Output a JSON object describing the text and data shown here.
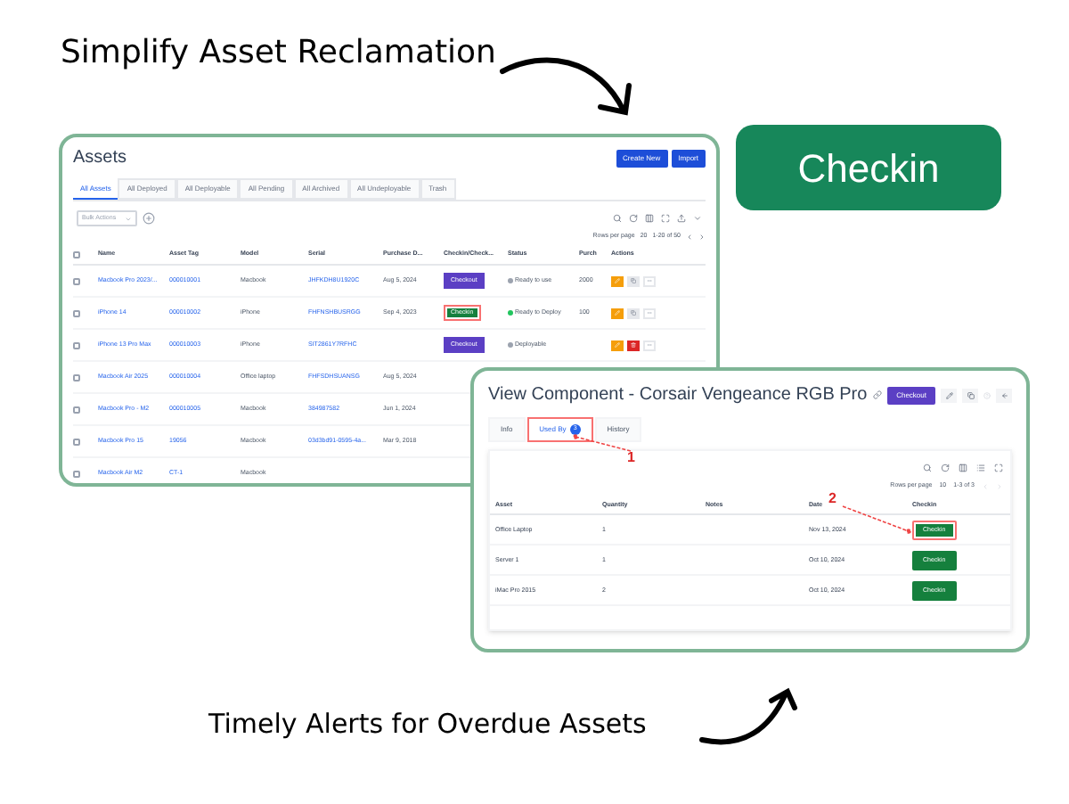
{
  "headline_top": "Simplify Asset Reclamation",
  "feature_button": "Checkin",
  "assets_window": {
    "title": "Assets",
    "buttons": [
      "Create New",
      "Import"
    ],
    "tabs": [
      {
        "label": "All Assets",
        "selected": true
      },
      {
        "label": "All Deployed",
        "selected": false
      },
      {
        "label": "All Deployable",
        "selected": false
      },
      {
        "label": "All Pending",
        "selected": false
      },
      {
        "label": "All Archived",
        "selected": false
      },
      {
        "label": "All Undeployable",
        "selected": false
      },
      {
        "label": "Trash",
        "selected": false
      }
    ],
    "bulk_select": {
      "placeholder": "Bulk Actions"
    },
    "rows_per_page_label": "Rows per page",
    "rows_per_page": "20",
    "range": "1-20 of 50",
    "header_checked": false,
    "columns": [
      "Name",
      "Asset Tag",
      "Model",
      "Serial",
      "Purchase D...",
      "Checkin/Check...",
      "Status",
      "Purch",
      "Actions"
    ],
    "rows": [
      {
        "checked": false,
        "name": "Macbook Pro 2023/...",
        "asset_tag": "000010001",
        "model": "Macbook",
        "serial": "JHFKDH8U1920C",
        "purchase_date": "Aug 5, 2024",
        "action": {
          "kind": "checkout",
          "label": "Checkout",
          "highlighted": false
        },
        "status": "Ready to use",
        "color": "#9ca3af",
        "cost": "2000",
        "deletable": false
      },
      {
        "checked": false,
        "name": "iPhone 14",
        "asset_tag": "000010002",
        "model": "iPhone",
        "serial": "FHFNSHBUSRGG",
        "purchase_date": "Sep 4, 2023",
        "action": {
          "kind": "checkin",
          "label": "Checkin",
          "highlighted": true
        },
        "status": "Ready to Deploy",
        "color": "#22c55e",
        "cost": "100",
        "deletable": false
      },
      {
        "checked": false,
        "name": "iPhone 13 Pro Max",
        "asset_tag": "000010003",
        "model": "iPhone",
        "serial": "SIT2861Y7RFHC",
        "action": {
          "kind": "checkout",
          "label": "Checkout",
          "highlighted": false
        },
        "status": "Deployable",
        "color": "#9ca3af",
        "deletable": true
      },
      {
        "checked": false,
        "name": "Macbook Air 2025",
        "asset_tag": "000010004",
        "model": "Office laptop",
        "serial": "FHFSDHSUANSG",
        "purchase_date": "Aug 5, 2024"
      },
      {
        "checked": false,
        "name": "Macbook Pro - M2",
        "asset_tag": "000010005",
        "model": "Macbook",
        "serial": "384987582",
        "purchase_date": "Jun 1, 2024"
      },
      {
        "checked": false,
        "name": "Macbook Pro 15",
        "asset_tag": "19056",
        "model": "Macbook",
        "serial": "03d3bd91-0595-4a...",
        "purchase_date": "Mar 9, 2018"
      },
      {
        "checked": false,
        "name": "Macbook Air M2",
        "asset_tag": "CT-1",
        "model": "Macbook"
      }
    ]
  },
  "component_window": {
    "title": "View Component - Corsair Vengeance RGB Pro",
    "checkout_button": "Checkout",
    "tabs": [
      {
        "label": "Info",
        "selected": false,
        "annotated": false
      },
      {
        "label": "Used By",
        "badge": "3",
        "selected": true,
        "annotated": true
      },
      {
        "label": "History",
        "selected": false,
        "annotated": false
      }
    ],
    "rows_per_page_label": "Rows per page",
    "rows_per_page": "10",
    "range": "1-3 of 3",
    "columns": [
      "Asset",
      "Quantity",
      "Notes",
      "Date",
      "Checkin"
    ],
    "rows": [
      {
        "asset": "Office Laptop",
        "quantity": "1",
        "date": "Nov 13, 2024",
        "button": "Checkin",
        "annotated": true
      },
      {
        "asset": "Server 1",
        "quantity": "1",
        "date": "Oct 10, 2024",
        "button": "Checkin",
        "annotated": false
      },
      {
        "asset": "iMac Pro 2015",
        "quantity": "2",
        "date": "Oct 10, 2024",
        "button": "Checkin",
        "annotated": false
      }
    ],
    "annotations": [
      "1",
      "2"
    ]
  },
  "headline_bottom": "Timely Alerts for Overdue Assets"
}
